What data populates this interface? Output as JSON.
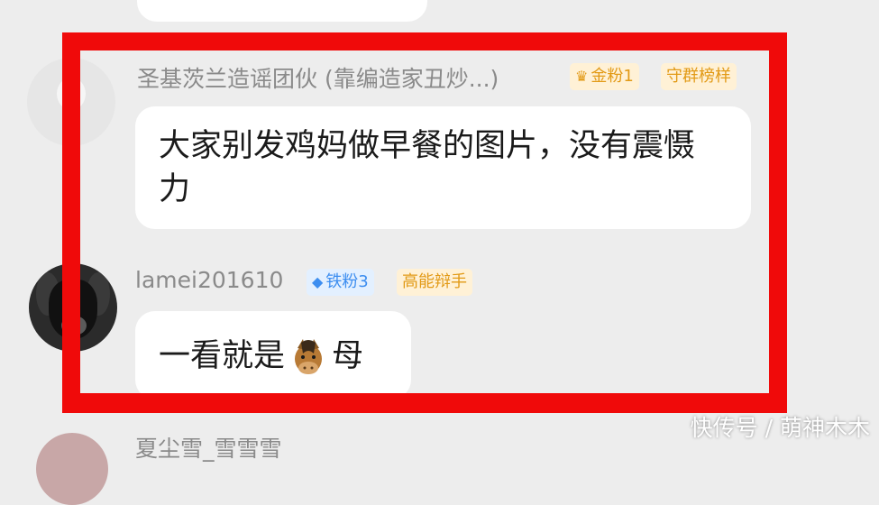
{
  "comments": [
    {
      "username": "圣基茨兰造谣团伙 (靠编造家丑炒...)",
      "fan_badge": "金粉1",
      "role_badge": "守群榜样",
      "message": "大家别发鸡妈做早餐的图片，没有震慑力"
    },
    {
      "username": "lamei201610",
      "fan_badge": "铁粉3",
      "role_badge": "高能辩手",
      "message_prefix": "一看就是",
      "message_emoji": "horse-face-emoji",
      "message_suffix": "母"
    },
    {
      "username": "夏尘雪_雪雪雪"
    }
  ],
  "watermark": "快传号 / 萌神木木",
  "colors": {
    "background": "#ededed",
    "highlight_frame": "#f00a0a",
    "gold_badge": "#e29a16",
    "iron_badge": "#3d8ef0"
  }
}
